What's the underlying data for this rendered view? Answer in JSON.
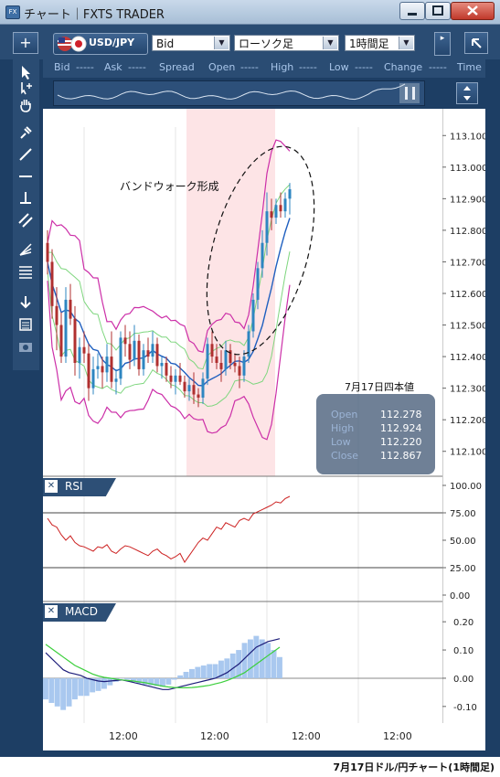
{
  "window": {
    "title": "チャート｜FXTS TRADER",
    "app_icon": "FX"
  },
  "toolbar": {
    "symbol": "USD/JPY",
    "price_type": "Bid",
    "chart_type": "ローソク足",
    "timeframe": "1時間足"
  },
  "quote_labels": [
    "Bid",
    "-----",
    "Ask",
    "-----",
    "Spread",
    "Open",
    "-----",
    "High",
    "-----",
    "Low",
    "-----",
    "Change",
    "-----",
    "Time"
  ],
  "price_axis": {
    "ticks": [
      "113.100",
      "113.000",
      "112.900",
      "112.800",
      "112.700",
      "112.600",
      "112.500",
      "112.400",
      "112.300",
      "112.200",
      "112.100"
    ]
  },
  "rsi": {
    "title": "RSI",
    "ticks": [
      "100.00",
      "75.00",
      "50.00",
      "25.00",
      "0.00"
    ]
  },
  "macd": {
    "title": "MACD",
    "ticks": [
      "0.20",
      "0.10",
      "0.00",
      "-0.10"
    ]
  },
  "time_axis": {
    "labels": [
      "12:00",
      "12:00",
      "12:00",
      "12:00"
    ]
  },
  "annotation": {
    "text": "バンドウォーク形成"
  },
  "ohlc_box": {
    "title": "7月17日四本値",
    "rows": [
      {
        "label": "Open",
        "value": "112.278"
      },
      {
        "label": "High",
        "value": "112.924"
      },
      {
        "label": "Low",
        "value": "112.220"
      },
      {
        "label": "Close",
        "value": "112.867"
      }
    ]
  },
  "caption": "7月17日ドル/円チャート(1時間足)",
  "colors": {
    "up": "#2e86c1",
    "down": "#b03030",
    "ma": "#1f5fbf",
    "band1": "#7ed67e",
    "band2": "#cc2fa8",
    "rsi": "#cc2020",
    "highlight": "#fde4e6"
  },
  "chart_data": {
    "type": "candlestick",
    "price_ylim": [
      112.05,
      113.15
    ],
    "candles_ohlc": [
      [
        112.76,
        112.8,
        112.66,
        112.7
      ],
      [
        112.7,
        112.74,
        112.52,
        112.56
      ],
      [
        112.56,
        112.62,
        112.42,
        112.5
      ],
      [
        112.5,
        112.54,
        112.38,
        112.4
      ],
      [
        112.4,
        112.62,
        112.38,
        112.58
      ],
      [
        112.58,
        112.63,
        112.5,
        112.52
      ],
      [
        112.52,
        112.56,
        112.34,
        112.38
      ],
      [
        112.38,
        112.46,
        112.33,
        112.43
      ],
      [
        112.43,
        112.48,
        112.38,
        112.41
      ],
      [
        112.41,
        112.44,
        112.26,
        112.3
      ],
      [
        112.3,
        112.4,
        112.28,
        112.36
      ],
      [
        112.36,
        112.41,
        112.33,
        112.37
      ],
      [
        112.37,
        112.4,
        112.3,
        112.35
      ],
      [
        112.35,
        112.44,
        112.32,
        112.4
      ],
      [
        112.4,
        112.48,
        112.3,
        112.32
      ],
      [
        112.32,
        112.36,
        112.28,
        112.33
      ],
      [
        112.33,
        112.48,
        112.31,
        112.46
      ],
      [
        112.46,
        112.5,
        112.4,
        112.44
      ],
      [
        112.44,
        112.48,
        112.36,
        112.39
      ],
      [
        112.39,
        112.5,
        112.37,
        112.45
      ],
      [
        112.45,
        112.47,
        112.34,
        112.36
      ],
      [
        112.36,
        112.44,
        112.34,
        112.42
      ],
      [
        112.42,
        112.46,
        112.38,
        112.4
      ],
      [
        112.4,
        112.48,
        112.38,
        112.44
      ],
      [
        112.44,
        112.46,
        112.35,
        112.37
      ],
      [
        112.37,
        112.4,
        112.33,
        112.38
      ],
      [
        112.38,
        112.4,
        112.32,
        112.34
      ],
      [
        112.34,
        112.37,
        112.3,
        112.32
      ],
      [
        112.32,
        112.36,
        112.28,
        112.34
      ],
      [
        112.34,
        112.38,
        112.31,
        112.32
      ],
      [
        112.32,
        112.34,
        112.27,
        112.29
      ],
      [
        112.29,
        112.33,
        112.26,
        112.31
      ],
      [
        112.31,
        112.35,
        112.25,
        112.28
      ],
      [
        112.28,
        112.3,
        112.24,
        112.27
      ],
      [
        112.27,
        112.35,
        112.25,
        112.33
      ],
      [
        112.33,
        112.46,
        112.31,
        112.44
      ],
      [
        112.44,
        112.48,
        112.38,
        112.4
      ],
      [
        112.4,
        112.44,
        112.36,
        112.38
      ],
      [
        112.38,
        112.42,
        112.32,
        112.36
      ],
      [
        112.36,
        112.45,
        112.34,
        112.42
      ],
      [
        112.42,
        112.44,
        112.36,
        112.38
      ],
      [
        112.38,
        112.41,
        112.35,
        112.37
      ],
      [
        112.37,
        112.4,
        112.3,
        112.34
      ],
      [
        112.34,
        112.42,
        112.32,
        112.4
      ],
      [
        112.4,
        112.5,
        112.38,
        112.48
      ],
      [
        112.48,
        112.6,
        112.46,
        112.58
      ],
      [
        112.58,
        112.7,
        112.55,
        112.68
      ],
      [
        112.68,
        112.8,
        112.65,
        112.76
      ],
      [
        112.76,
        112.92,
        112.72,
        112.86
      ],
      [
        112.86,
        112.9,
        112.8,
        112.84
      ],
      [
        112.84,
        112.9,
        112.82,
        112.88
      ],
      [
        112.88,
        112.92,
        112.84,
        112.86
      ],
      [
        112.86,
        112.92,
        112.84,
        112.9
      ],
      [
        112.9,
        112.95,
        112.85,
        112.93
      ]
    ],
    "rsi": [
      70,
      64,
      62,
      55,
      50,
      54,
      48,
      45,
      44,
      42,
      40,
      44,
      43,
      46,
      40,
      38,
      42,
      45,
      44,
      42,
      40,
      38,
      36,
      40,
      42,
      38,
      36,
      33,
      35,
      38,
      30,
      36,
      42,
      48,
      52,
      50,
      56,
      62,
      60,
      66,
      64,
      62,
      68,
      70,
      68,
      74,
      76,
      78,
      80,
      82,
      85,
      84,
      88,
      90
    ],
    "macd": [
      0.09,
      0.07,
      0.05,
      0.03,
      0.02,
      0.015,
      0.01,
      0.0,
      -0.005,
      -0.01,
      -0.012,
      -0.01,
      -0.008,
      -0.006,
      -0.01,
      -0.015,
      -0.02,
      -0.025,
      -0.03,
      -0.035,
      -0.04,
      -0.04,
      -0.035,
      -0.03,
      -0.025,
      -0.02,
      -0.015,
      -0.01,
      -0.005,
      0.0,
      0.01,
      0.02,
      0.035,
      0.05,
      0.07,
      0.09,
      0.11,
      0.12,
      0.13,
      0.135,
      0.14
    ],
    "signal": [
      0.12,
      0.105,
      0.09,
      0.075,
      0.06,
      0.045,
      0.035,
      0.025,
      0.015,
      0.008,
      0.003,
      0.0,
      -0.003,
      -0.006,
      -0.008,
      -0.01,
      -0.013,
      -0.016,
      -0.02,
      -0.024,
      -0.028,
      -0.031,
      -0.033,
      -0.034,
      -0.034,
      -0.033,
      -0.031,
      -0.028,
      -0.025,
      -0.02,
      -0.015,
      -0.008,
      0.0,
      0.01,
      0.02,
      0.035,
      0.05,
      0.065,
      0.08,
      0.095,
      0.11
    ]
  }
}
